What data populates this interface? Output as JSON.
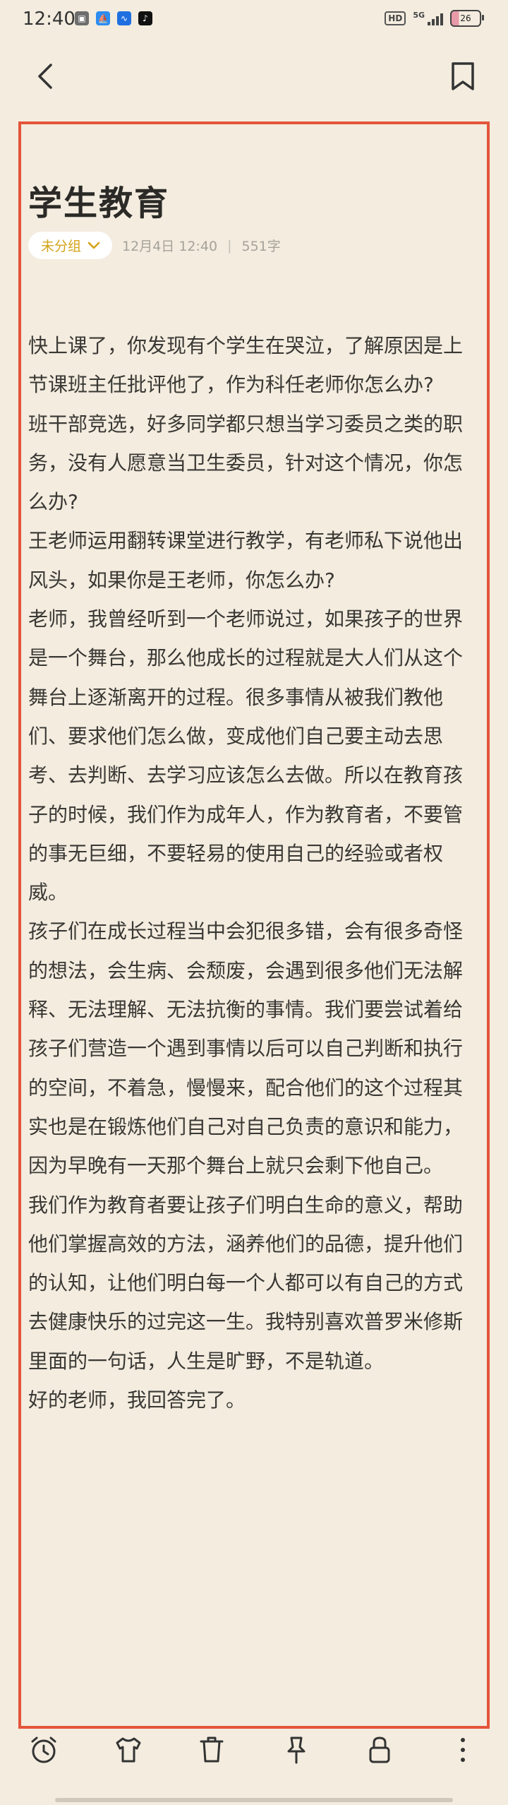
{
  "status_bar": {
    "time": "12:40",
    "network": "5G",
    "hd": "HD",
    "battery": "26",
    "battery_level": 0.26
  },
  "header": {
    "back_icon": "chevron-left-icon",
    "bookmark_icon": "bookmark-icon"
  },
  "note": {
    "title": "学生教育",
    "group_label": "未分组",
    "date": "12月4日 12:40",
    "separator": "|",
    "word_count": "551字",
    "paragraphs": [
      "快上课了，你发现有个学生在哭泣，了解原因是上节课班主任批评他了，作为科任老师你怎么办?",
      "班干部竞选，好多同学都只想当学习委员之类的职务，没有人愿意当卫生委员，针对这个情况，你怎么办?",
      "王老师运用翻转课堂进行教学，有老师私下说他出风头，如果你是王老师，你怎么办?",
      "老师，我曾经听到一个老师说过，如果孩子的世界是一个舞台，那么他成长的过程就是大人们从这个舞台上逐渐离开的过程。很多事情从被我们教他们、要求他们怎么做，变成他们自己要主动去思考、去判断、去学习应该怎么去做。所以在教育孩子的时候，我们作为成年人，作为教育者，不要管的事无巨细，不要轻易的使用自己的经验或者权威。",
      "孩子们在成长过程当中会犯很多错，会有很多奇怪的想法，会生病、会颓废，会遇到很多他们无法解释、无法理解、无法抗衡的事情。我们要尝试着给孩子们营造一个遇到事情以后可以自己判断和执行的空间，不着急，慢慢来，配合他们的这个过程其实也是在锻炼他们自己对自己负责的意识和能力，因为早晚有一天那个舞台上就只会剩下他自己。",
      "我们作为教育者要让孩子们明白生命的意义，帮助他们掌握高效的方法，涵养他们的品德，提升他们的认知，让他们明白每一个人都可以有自己的方式去健康快乐的过完这一生。我特别喜欢普罗米修斯里面的一句话，人生是旷野，不是轨道。",
      "好的老师，我回答完了。"
    ]
  },
  "toolbar": {
    "items": [
      "alarm-clock-icon",
      "shirt-icon",
      "trash-icon",
      "pin-icon",
      "lock-icon",
      "more-vertical-icon"
    ]
  },
  "colors": {
    "background": "#f3ecdf",
    "accent": "#d4a31a",
    "annotation": "#e4553a"
  }
}
